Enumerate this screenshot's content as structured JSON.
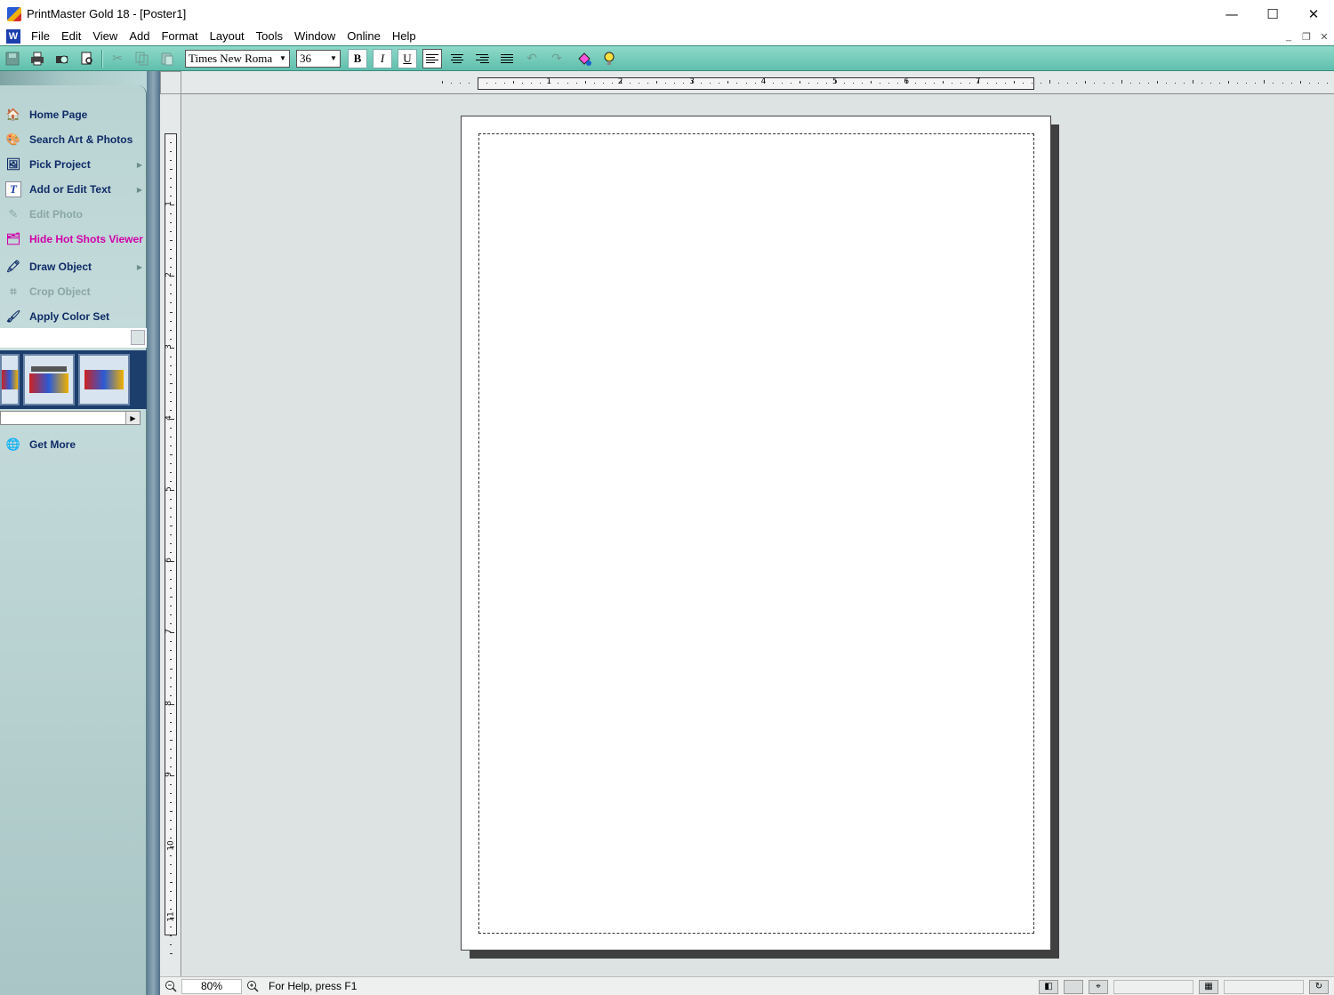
{
  "window": {
    "title": "PrintMaster Gold 18 - [Poster1]",
    "controls": {
      "minimize": "—",
      "maximize": "☐",
      "close": "✕"
    }
  },
  "menu": {
    "items": [
      "File",
      "Edit",
      "View",
      "Add",
      "Format",
      "Layout",
      "Tools",
      "Window",
      "Online",
      "Help"
    ],
    "mdi": {
      "minimize": "_",
      "restore": "❐",
      "close": "✕"
    }
  },
  "toolbar": {
    "font_name": "Times New Roma",
    "font_size": "36",
    "bold_label": "B",
    "italic_label": "I",
    "underline_label": "U",
    "icons": [
      "save-icon",
      "print-icon",
      "print-preview-icon",
      "page-view-icon",
      "cut-icon",
      "copy-icon",
      "paste-icon",
      "align-left-icon",
      "align-center-icon",
      "align-right-icon",
      "justify-icon",
      "undo-icon",
      "redo-icon",
      "color-fill-icon",
      "lightbulb-icon"
    ]
  },
  "sidebar": {
    "tasks": [
      {
        "label": "Home Page",
        "icon": "home-icon",
        "state": "enabled",
        "has_submenu": false
      },
      {
        "label": "Search Art & Photos",
        "icon": "search-art-icon",
        "state": "enabled",
        "has_submenu": false
      },
      {
        "label": "Pick Project",
        "icon": "project-icon",
        "state": "enabled",
        "has_submenu": true
      },
      {
        "label": "Add or Edit Text",
        "icon": "text-icon",
        "state": "enabled",
        "has_submenu": true
      },
      {
        "label": "Edit Photo",
        "icon": "edit-photo-icon",
        "state": "disabled",
        "has_submenu": false
      },
      {
        "label": "Hide Hot Shots Viewer",
        "icon": "hot-shots-icon",
        "state": "highlight",
        "has_submenu": false
      },
      {
        "label": "Draw Object",
        "icon": "draw-icon",
        "state": "enabled",
        "has_submenu": true
      },
      {
        "label": "Crop Object",
        "icon": "crop-icon",
        "state": "disabled",
        "has_submenu": false
      },
      {
        "label": "Apply Color Set",
        "icon": "color-set-icon",
        "state": "enabled",
        "has_submenu": false
      }
    ],
    "get_more": "Get More"
  },
  "ruler": {
    "h_labels": [
      "1",
      "2",
      "3",
      "4",
      "5",
      "6",
      "7"
    ],
    "v_labels": [
      "1",
      "2",
      "3",
      "4",
      "5",
      "6",
      "7",
      "8",
      "9",
      "10",
      "11"
    ]
  },
  "statusbar": {
    "zoom": "80%",
    "help_text": "For Help, press F1"
  },
  "colors": {
    "toolbar": "#6fcbb8",
    "task_text": "#0e2b66",
    "task_highlight": "#d000a8",
    "workspace": "#dde3e3"
  }
}
